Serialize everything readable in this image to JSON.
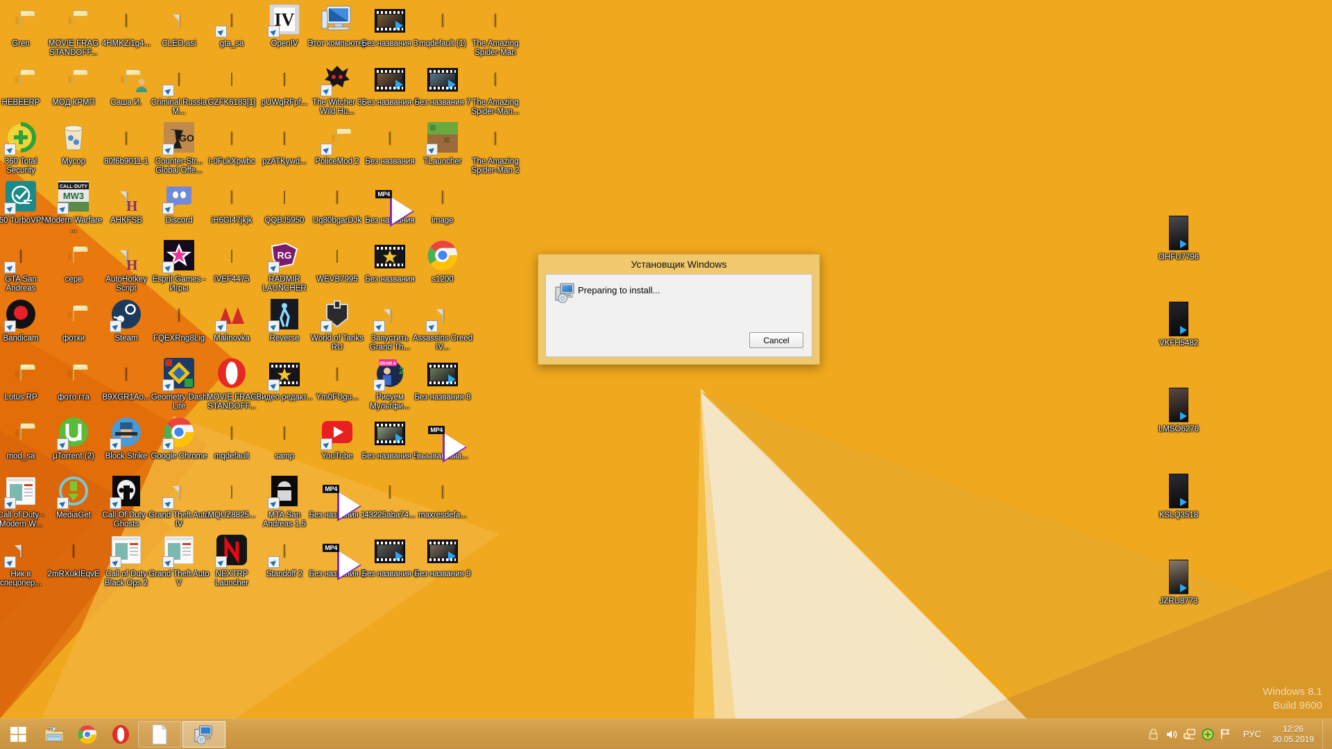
{
  "os": {
    "watermark_line1": "Windows 8.1",
    "watermark_line2": "Build 9600"
  },
  "wallpaper": {
    "base_color": "#f0a81e",
    "shade_color": "#e8760f",
    "light_color": "#f5c14a",
    "cream_color": "#efe0c0"
  },
  "desktop_icons": [
    {
      "label": "Gren",
      "type": "folder",
      "col": 0,
      "row": 0
    },
    {
      "label": "MOVIE FRAG STANDOFF...",
      "type": "folder",
      "col": 1,
      "row": 0
    },
    {
      "label": "4HMKZi1g4...",
      "type": "thumb",
      "col": 2,
      "row": 0,
      "color": "#6b4a24"
    },
    {
      "label": "CLEO.asi",
      "type": "doc",
      "col": 3,
      "row": 0
    },
    {
      "label": "gta_sa",
      "type": "thumb-square",
      "col": 4,
      "row": 0,
      "color": "#c08b52",
      "shortcut": true
    },
    {
      "label": "OpenIV",
      "type": "app-openiv",
      "col": 5,
      "row": 0,
      "shortcut": true
    },
    {
      "label": "Этот компьютер",
      "type": "this-pc",
      "col": 6,
      "row": 0
    },
    {
      "label": "Без названия 3",
      "type": "filmstrip",
      "col": 7,
      "row": 0,
      "color": "#7a5a3a"
    },
    {
      "label": "mqdefault (1)",
      "type": "thumb",
      "col": 8,
      "row": 0,
      "color": "#3a2a1a"
    },
    {
      "label": "The Amazing Spider-Man",
      "type": "thumb",
      "col": 9,
      "row": 0,
      "color": "#a01020"
    },
    {
      "label": "НЕВЕЕRP",
      "type": "folder",
      "col": 0,
      "row": 1
    },
    {
      "label": "МОД КРМП",
      "type": "folder",
      "col": 1,
      "row": 1
    },
    {
      "label": "Саша И.",
      "type": "folder-user",
      "col": 2,
      "row": 1
    },
    {
      "label": "Criminal Russia M...",
      "type": "thumb-square",
      "col": 3,
      "row": 1,
      "color": "#b03522",
      "shortcut": true
    },
    {
      "label": "GZFK6183[1]",
      "type": "thumb-tall",
      "col": 4,
      "row": 1,
      "color": "#c08050"
    },
    {
      "label": "pUWqRFpf...",
      "type": "thumb",
      "col": 5,
      "row": 1,
      "color": "#8a7a6a"
    },
    {
      "label": "The Witcher 3 Wild Hu...",
      "type": "witcher",
      "col": 6,
      "row": 1,
      "shortcut": true
    },
    {
      "label": "Без названия 4",
      "type": "filmstrip",
      "col": 7,
      "row": 1,
      "color": "#7a5a3a"
    },
    {
      "label": "Без названия 7",
      "type": "filmstrip",
      "col": 8,
      "row": 1,
      "color": "#5a7a8a"
    },
    {
      "label": "The Amazing Spider-Man...",
      "type": "thumb",
      "col": 9,
      "row": 1,
      "color": "#8a1020"
    },
    {
      "label": "360 Total Security",
      "type": "app-360",
      "col": 0,
      "row": 2,
      "shortcut": true
    },
    {
      "label": "Мусор",
      "type": "recycle-bin",
      "col": 1,
      "row": 2
    },
    {
      "label": "80f6b9011-1",
      "type": "thumb",
      "col": 2,
      "row": 2,
      "color": "#8a1020"
    },
    {
      "label": "Counter-Str... Global Offe...",
      "type": "csgo",
      "col": 3,
      "row": 2,
      "shortcut": true
    },
    {
      "label": "I-0FukXpwbc",
      "type": "thumb",
      "col": 4,
      "row": 2,
      "color": "#4a4a4a"
    },
    {
      "label": "pzATKywd...",
      "type": "thumb",
      "col": 5,
      "row": 2,
      "color": "#7a5a3a"
    },
    {
      "label": "PoliceMod 2",
      "type": "folder",
      "col": 6,
      "row": 2,
      "shortcut": true
    },
    {
      "label": "Без названия",
      "type": "thumb-square",
      "col": 7,
      "row": 2,
      "color": "#2aa0d0"
    },
    {
      "label": "TLauncher",
      "type": "minecraft",
      "col": 8,
      "row": 2,
      "shortcut": true
    },
    {
      "label": "The Amazing Spider-Man 2",
      "type": "thumb",
      "col": 9,
      "row": 2,
      "color": "#8a1020"
    },
    {
      "label": "360 TurboVPN",
      "type": "app-turbovpn",
      "col": 0,
      "row": 3,
      "shortcut": true
    },
    {
      "label": "Modern Warfare ...",
      "type": "cod-mw3",
      "col": 1,
      "row": 3,
      "shortcut": true
    },
    {
      "label": "AHKFSB",
      "type": "ahk-doc",
      "col": 2,
      "row": 3
    },
    {
      "label": "Discord",
      "type": "discord",
      "col": 3,
      "row": 3,
      "shortcut": true
    },
    {
      "label": "iH6GI47jkjk",
      "type": "thumb",
      "col": 4,
      "row": 3,
      "color": "#4a4436"
    },
    {
      "label": "QQBJ5950",
      "type": "thumb-tall",
      "col": 5,
      "row": 3,
      "color": "#c09070"
    },
    {
      "label": "Uq80bgarDJk",
      "type": "thumb",
      "col": 6,
      "row": 3,
      "color": "#f0f0f0"
    },
    {
      "label": "Без названия",
      "type": "mp4",
      "col": 7,
      "row": 3
    },
    {
      "label": "image",
      "type": "thumb",
      "col": 8,
      "row": 3,
      "color": "#201040"
    },
    {
      "label": "GTA San Andreas",
      "type": "thumb-square",
      "col": 0,
      "row": 4,
      "color": "#c08b52",
      "shortcut": true
    },
    {
      "label": "серв",
      "type": "folder",
      "col": 1,
      "row": 4
    },
    {
      "label": "AutoHotkey Script",
      "type": "ahk-doc",
      "col": 2,
      "row": 4
    },
    {
      "label": "Esprit Games - Игры",
      "type": "esprit",
      "col": 3,
      "row": 4,
      "shortcut": true
    },
    {
      "label": "IVEF4475",
      "type": "thumb-tall",
      "col": 4,
      "row": 4,
      "color": "#5a4a3a"
    },
    {
      "label": "RADMIR LAUNCHER",
      "type": "radmir",
      "col": 5,
      "row": 4,
      "shortcut": true
    },
    {
      "label": "WEVB7995",
      "type": "thumb-tall",
      "col": 6,
      "row": 4,
      "color": "#6a5a4a"
    },
    {
      "label": "Без названия",
      "type": "filmstrip-star",
      "col": 7,
      "row": 4
    },
    {
      "label": "s1200",
      "type": "chrome",
      "col": 8,
      "row": 4
    },
    {
      "label": "Bandicam",
      "type": "bandicam",
      "col": 0,
      "row": 5,
      "shortcut": true
    },
    {
      "label": "фотки",
      "type": "folder",
      "col": 1,
      "row": 5
    },
    {
      "label": "Steam",
      "type": "steam",
      "col": 2,
      "row": 5,
      "shortcut": true
    },
    {
      "label": "FQEXRng8Lig",
      "type": "thumb",
      "col": 3,
      "row": 5,
      "color": "#9a8a7a"
    },
    {
      "label": "Malinovka",
      "type": "malinovka",
      "col": 4,
      "row": 5,
      "shortcut": true
    },
    {
      "label": "Reverse",
      "type": "reverse",
      "col": 5,
      "row": 5,
      "shortcut": true
    },
    {
      "label": "World of Tanks RU",
      "type": "wot",
      "col": 6,
      "row": 5,
      "shortcut": true
    },
    {
      "label": "Запустить Grand Th...",
      "type": "doc",
      "col": 7,
      "row": 5,
      "shortcut": true
    },
    {
      "label": "Assassins Creed IV...",
      "type": "doc",
      "col": 8,
      "row": 5,
      "shortcut": true
    },
    {
      "label": "Lotus RP",
      "type": "folder",
      "col": 0,
      "row": 6
    },
    {
      "label": "фото гта",
      "type": "folder",
      "col": 1,
      "row": 6
    },
    {
      "label": "B9XGR1Ao...",
      "type": "thumb",
      "col": 2,
      "row": 6,
      "color": "#3a3a4a"
    },
    {
      "label": "Geometry Dash Lite",
      "type": "geometry-dash",
      "col": 3,
      "row": 6,
      "shortcut": true
    },
    {
      "label": "MOVIE FRAG STANDOFF...",
      "type": "opera",
      "col": 4,
      "row": 6
    },
    {
      "label": "Видео редакт...",
      "type": "filmstrip-star",
      "col": 5,
      "row": 6,
      "shortcut": true
    },
    {
      "label": "Ym0FUgu...",
      "type": "thumb",
      "col": 6,
      "row": 6,
      "color": "#6a6a6a"
    },
    {
      "label": "Рисуем Мультфи...",
      "type": "draw-cartoon",
      "col": 7,
      "row": 6,
      "shortcut": true
    },
    {
      "label": "Без названия 8",
      "type": "filmstrip",
      "col": 8,
      "row": 6,
      "color": "#6a7a5a"
    },
    {
      "label": "mod_sa",
      "type": "folder",
      "col": 0,
      "row": 7
    },
    {
      "label": "μTorrent (2)",
      "type": "utorrent",
      "col": 1,
      "row": 7,
      "shortcut": true
    },
    {
      "label": "Block Strike",
      "type": "block-strike",
      "col": 2,
      "row": 7,
      "shortcut": true
    },
    {
      "label": "Google Chrome",
      "type": "chrome",
      "col": 3,
      "row": 7,
      "shortcut": true
    },
    {
      "label": "mqdefault",
      "type": "thumb",
      "col": 4,
      "row": 7,
      "color": "#201040"
    },
    {
      "label": "samp",
      "type": "thumb-square",
      "col": 5,
      "row": 7,
      "color": "#c0a080"
    },
    {
      "label": "YouTube",
      "type": "youtube",
      "col": 6,
      "row": 7,
      "shortcut": true
    },
    {
      "label": "Без названия 5",
      "type": "filmstrip",
      "col": 7,
      "row": 7,
      "color": "#8a9a7a"
    },
    {
      "label": "выываыаыа...",
      "type": "mp4",
      "col": 8,
      "row": 7
    },
    {
      "label": "Call of Duty - Modern W...",
      "type": "generic-app",
      "col": 0,
      "row": 8,
      "shortcut": true
    },
    {
      "label": "MediaGet",
      "type": "mediaget",
      "col": 1,
      "row": 8,
      "shortcut": true
    },
    {
      "label": "Call Of Duty - Ghosts",
      "type": "cod-ghosts",
      "col": 2,
      "row": 8,
      "shortcut": true
    },
    {
      "label": "Grand Theft Auto IV",
      "type": "doc",
      "col": 3,
      "row": 8,
      "shortcut": true
    },
    {
      "label": "MQUZ8825...",
      "type": "thumb-tall",
      "col": 4,
      "row": 8,
      "color": "#6a5a4a"
    },
    {
      "label": "MTA San Andreas 1.5",
      "type": "mta",
      "col": 5,
      "row": 8,
      "shortcut": true
    },
    {
      "label": "Без названия 1",
      "type": "mp4",
      "col": 6,
      "row": 8
    },
    {
      "label": "43225aba74...",
      "type": "thumb",
      "col": 7,
      "row": 8,
      "color": "#0a0a0a"
    },
    {
      "label": "maxresdefa...",
      "type": "thumb",
      "col": 8,
      "row": 8,
      "color": "#d020a0"
    },
    {
      "label": "Ник в спецопер...",
      "type": "doc",
      "col": 0,
      "row": 9,
      "shortcut": true
    },
    {
      "label": "2mRXukIEqvE",
      "type": "thumb",
      "col": 1,
      "row": 9,
      "color": "#1a2a3a"
    },
    {
      "label": "Call of Duty Black Ops 2",
      "type": "generic-app",
      "col": 2,
      "row": 9,
      "shortcut": true
    },
    {
      "label": "Grand Theft Auto V",
      "type": "generic-app",
      "col": 3,
      "row": 9,
      "shortcut": true
    },
    {
      "label": "NEXTRP Launcher",
      "type": "nextrp",
      "col": 4,
      "row": 9,
      "shortcut": true
    },
    {
      "label": "Standoff 2",
      "type": "thumb-square",
      "col": 5,
      "row": 9,
      "color": "#b07040",
      "shortcut": true
    },
    {
      "label": "Без названия 2",
      "type": "mp4",
      "col": 6,
      "row": 9
    },
    {
      "label": "Без названия 6",
      "type": "filmstrip",
      "col": 7,
      "row": 9,
      "color": "#5a5a5a"
    },
    {
      "label": "Без названия 9",
      "type": "filmstrip",
      "col": 8,
      "row": 9,
      "color": "#7a6a5a"
    }
  ],
  "right_column_icons": [
    {
      "label": "OHFU7796",
      "color": "#4a4a52"
    },
    {
      "label": "VKFH5482",
      "color": "#22222a"
    },
    {
      "label": "LMSO6276",
      "color": "#5a4a42"
    },
    {
      "label": "KSLQ3518",
      "color": "#2a2a32"
    },
    {
      "label": "JZRU8773",
      "color": "#8a7a6a"
    }
  ],
  "installer_dialog": {
    "title": "Установщик Windows",
    "status_text": "Preparing to install...",
    "cancel_label": "Cancel",
    "titlebar_color": "#f0c86e",
    "body_color": "#f1f1f1"
  },
  "taskbar": {
    "start_label": "Start",
    "pinned": [
      {
        "name": "file-explorer",
        "label": "File Explorer"
      },
      {
        "name": "google-chrome",
        "label": "Google Chrome"
      },
      {
        "name": "opera",
        "label": "Opera"
      }
    ],
    "windows": [
      {
        "name": "document-window",
        "label": "Document",
        "active": false
      },
      {
        "name": "windows-installer-window",
        "label": "Установщик Windows",
        "active": true
      }
    ],
    "tray": {
      "icons": [
        {
          "name": "lock-icon",
          "label": "Lock"
        },
        {
          "name": "volume-icon",
          "label": "Volume"
        },
        {
          "name": "network-icon",
          "label": "Network"
        },
        {
          "name": "security-shield-icon",
          "label": "360 Total Security"
        },
        {
          "name": "action-center-flag-icon",
          "label": "Action Center"
        }
      ],
      "language": "РУС",
      "time": "12:26",
      "date": "30.05.2019"
    }
  }
}
